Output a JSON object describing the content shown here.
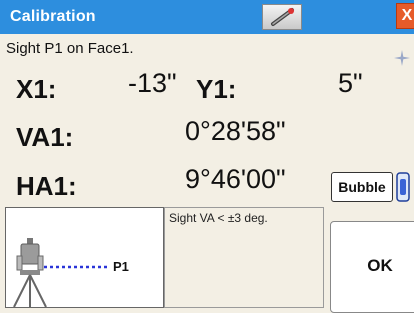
{
  "window": {
    "title": "Calibration",
    "close_label": "X"
  },
  "instruction": "Sight P1 on Face1.",
  "readings": {
    "x1_label": "X1:",
    "x1_value": "-13\"",
    "y1_label": "Y1:",
    "y1_value": "5\"",
    "va1_label": "VA1:",
    "va1_value": "0°28'58\"",
    "ha1_label": "HA1:",
    "ha1_value": "9°46'00\""
  },
  "note": "Sight VA < ±3 deg.",
  "diagram": {
    "point_label": "P1"
  },
  "buttons": {
    "bubble": "Bubble",
    "ok": "OK"
  },
  "icons": {
    "title_tool": "laser-pointer-icon",
    "sparkle": "sparkle-icon",
    "bubble_level": "bubble-level-icon",
    "instrument": "total-station-icon"
  },
  "colors": {
    "titlebar": "#2d8ede",
    "close": "#e65b2a",
    "background": "#f3efe4",
    "sight_line": "#2a35d8"
  }
}
